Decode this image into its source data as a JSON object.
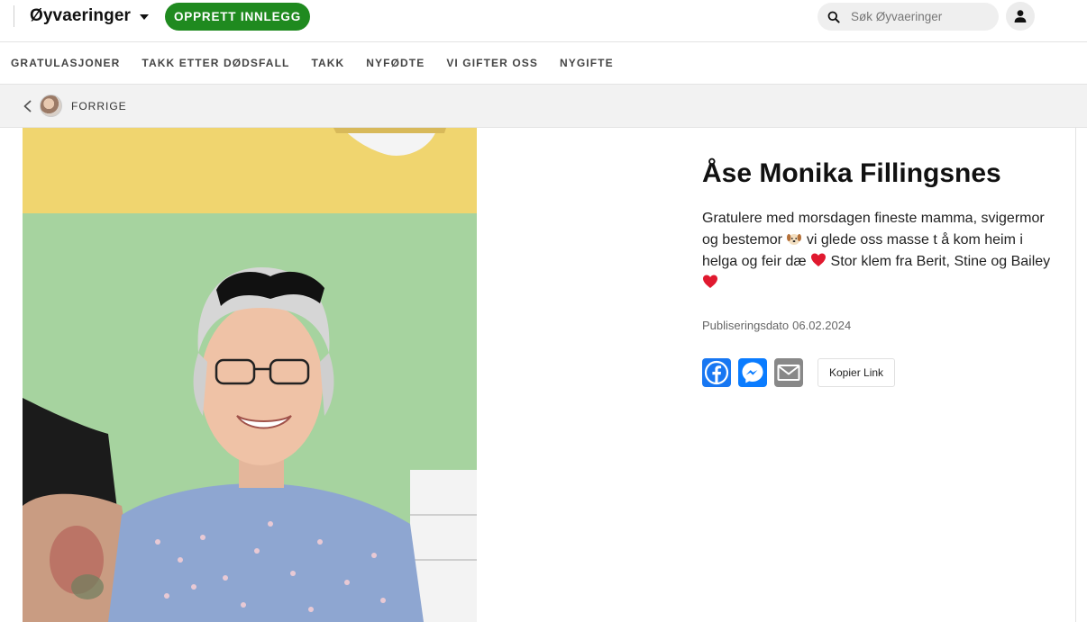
{
  "header": {
    "brand": "Øyvaeringer",
    "create_button": "OPPRETT INNLEGG",
    "search_placeholder": "Søk Øyvaeringer"
  },
  "categories": [
    {
      "label": "GRATULASJONER"
    },
    {
      "label": "TAKK ETTER DØDSFALL"
    },
    {
      "label": "TAKK"
    },
    {
      "label": "NYFØDTE"
    },
    {
      "label": "VI GIFTER OSS"
    },
    {
      "label": "NYGIFTE"
    }
  ],
  "back": {
    "label": "FORRIGE"
  },
  "post": {
    "title": "Åse Monika Fillingsnes",
    "body_part1": "Gratulere med morsdagen fineste mamma, svigermor og bestemor ",
    "body_part2": " vi glede oss masse t å kom heim i helga og feir dæ ",
    "body_part3": " Stor klem fra Berit, Stine og Bailey ",
    "pub_label": "Publiseringsdato",
    "pub_date": "06.02.2024"
  },
  "share": {
    "copy_link": "Kopier Link"
  },
  "colors": {
    "accent_green": "#1f8a1f",
    "facebook_blue": "#1877f2",
    "messenger_blue": "#0a7cff",
    "email_gray": "#888888"
  },
  "icons": {
    "search": "search-icon",
    "user": "user-icon",
    "back": "chevron-left-icon",
    "facebook": "facebook-icon",
    "messenger": "messenger-icon",
    "email": "email-icon"
  }
}
